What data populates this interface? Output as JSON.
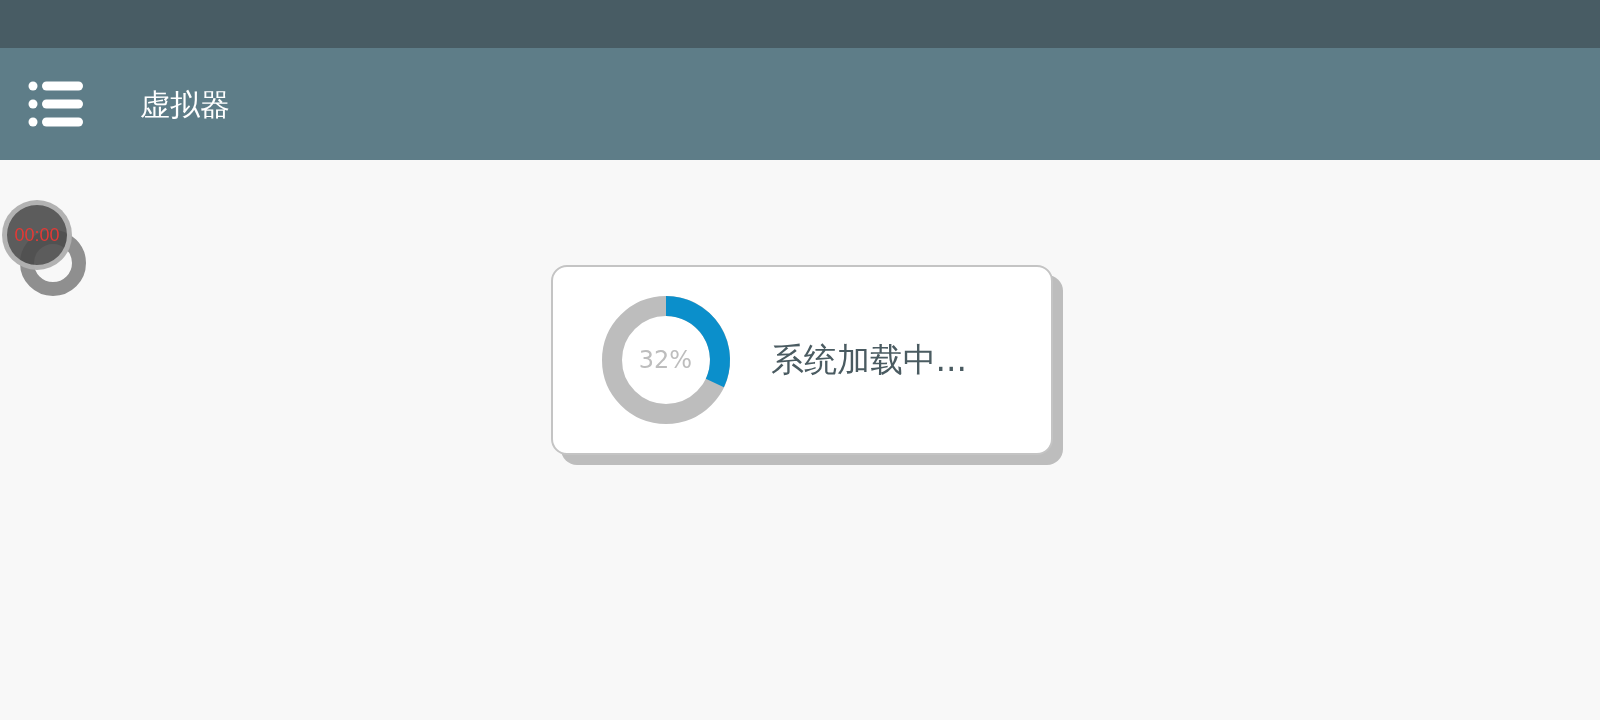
{
  "app_bar": {
    "title": "虚拟器"
  },
  "timer": {
    "time": "00:00"
  },
  "loading": {
    "percent": "32%",
    "message": "系统加载中..."
  }
}
